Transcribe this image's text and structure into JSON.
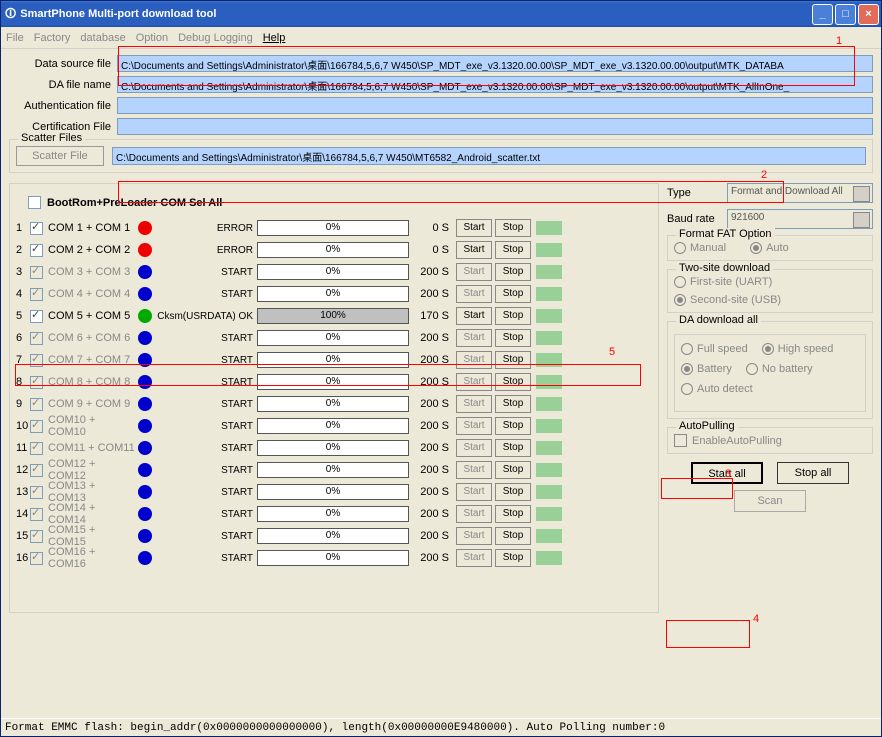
{
  "window_title": "SmartPhone Multi-port download tool",
  "menu": [
    "File",
    "Factory",
    "database",
    "Option",
    "Debug Logging",
    "Help"
  ],
  "menu_active_index": 5,
  "files": {
    "data_source_label": "Data source file",
    "data_source_value": "C:\\Documents and Settings\\Administrator\\桌面\\166784,5,6,7 W450\\SP_MDT_exe_v3.1320.00.00\\SP_MDT_exe_v3.1320.00.00\\output\\MTK_DATABA",
    "da_label": "DA file name",
    "da_value": "C:\\Documents and Settings\\Administrator\\桌面\\166784,5,6,7 W450\\SP_MDT_exe_v3.1320.00.00\\SP_MDT_exe_v3.1320.00.00\\output\\MTK_AllInOne_",
    "auth_label": "Authentication file",
    "auth_value": "",
    "cert_label": "Certification File",
    "cert_value": ""
  },
  "scatter": {
    "legend": "Scatter Files",
    "button": "Scatter File",
    "value": "C:\\Documents and Settings\\Administrator\\桌面\\166784,5,6,7 W450\\MT6582_Android_scatter.txt"
  },
  "com_header": "BootRom+PreLoader COM Sel All",
  "start_label": "Start",
  "stop_label": "Stop",
  "cols": {
    "progress_0": "0%",
    "progress_100": "100%",
    "s0": "0 S",
    "s170": "170 S",
    "s200": "200 S"
  },
  "rows": [
    {
      "idx": "1",
      "name": "COM 1 + COM 1",
      "gray": false,
      "dot": "red",
      "status": "ERROR",
      "pct": "0%",
      "full": false,
      "time": "0 S",
      "start_enabled": true
    },
    {
      "idx": "2",
      "name": "COM 2 + COM 2",
      "gray": false,
      "dot": "red",
      "status": "ERROR",
      "pct": "0%",
      "full": false,
      "time": "0 S",
      "start_enabled": true
    },
    {
      "idx": "3",
      "name": "COM 3 + COM 3",
      "gray": true,
      "dot": "blue",
      "status": "START",
      "pct": "0%",
      "full": false,
      "time": "200 S",
      "start_enabled": false
    },
    {
      "idx": "4",
      "name": "COM 4 + COM 4",
      "gray": true,
      "dot": "blue",
      "status": "START",
      "pct": "0%",
      "full": false,
      "time": "200 S",
      "start_enabled": false
    },
    {
      "idx": "5",
      "name": "COM 5 + COM 5",
      "gray": false,
      "dot": "green",
      "status": "Cksm(USRDATA) OK",
      "pct": "100%",
      "full": true,
      "time": "170 S",
      "start_enabled": true
    },
    {
      "idx": "6",
      "name": "COM 6 + COM 6",
      "gray": true,
      "dot": "blue",
      "status": "START",
      "pct": "0%",
      "full": false,
      "time": "200 S",
      "start_enabled": false
    },
    {
      "idx": "7",
      "name": "COM 7 + COM 7",
      "gray": true,
      "dot": "blue",
      "status": "START",
      "pct": "0%",
      "full": false,
      "time": "200 S",
      "start_enabled": false
    },
    {
      "idx": "8",
      "name": "COM 8 + COM 8",
      "gray": true,
      "dot": "blue",
      "status": "START",
      "pct": "0%",
      "full": false,
      "time": "200 S",
      "start_enabled": false
    },
    {
      "idx": "9",
      "name": "COM 9 + COM 9",
      "gray": true,
      "dot": "blue",
      "status": "START",
      "pct": "0%",
      "full": false,
      "time": "200 S",
      "start_enabled": false
    },
    {
      "idx": "10",
      "name": "COM10 + COM10",
      "gray": true,
      "dot": "blue",
      "status": "START",
      "pct": "0%",
      "full": false,
      "time": "200 S",
      "start_enabled": false
    },
    {
      "idx": "11",
      "name": "COM11 + COM11",
      "gray": true,
      "dot": "blue",
      "status": "START",
      "pct": "0%",
      "full": false,
      "time": "200 S",
      "start_enabled": false
    },
    {
      "idx": "12",
      "name": "COM12 + COM12",
      "gray": true,
      "dot": "blue",
      "status": "START",
      "pct": "0%",
      "full": false,
      "time": "200 S",
      "start_enabled": false
    },
    {
      "idx": "13",
      "name": "COM13 + COM13",
      "gray": true,
      "dot": "blue",
      "status": "START",
      "pct": "0%",
      "full": false,
      "time": "200 S",
      "start_enabled": false
    },
    {
      "idx": "14",
      "name": "COM14 + COM14",
      "gray": true,
      "dot": "blue",
      "status": "START",
      "pct": "0%",
      "full": false,
      "time": "200 S",
      "start_enabled": false
    },
    {
      "idx": "15",
      "name": "COM15 + COM15",
      "gray": true,
      "dot": "blue",
      "status": "START",
      "pct": "0%",
      "full": false,
      "time": "200 S",
      "start_enabled": false
    },
    {
      "idx": "16",
      "name": "COM16 + COM16",
      "gray": true,
      "dot": "blue",
      "status": "START",
      "pct": "0%",
      "full": false,
      "time": "200 S",
      "start_enabled": false
    }
  ],
  "side": {
    "type_label": "Type",
    "type_value": "Format and Download All",
    "baud_label": "Baud rate",
    "baud_value": "921600",
    "fat_legend": "Format FAT Option",
    "fat_manual": "Manual",
    "fat_auto": "Auto",
    "two_legend": "Two-site download",
    "two_first": "First-site (UART)",
    "two_second": "Second-site (USB)",
    "da_legend": "DA download all",
    "da_full": "Full speed",
    "da_high": "High speed",
    "da_batt": "Battery",
    "da_nobatt": "No battery",
    "da_auto": "Auto detect",
    "auto_legend": "AutoPulling",
    "auto_chk": "EnableAutoPulling",
    "start_all": "Start all",
    "stop_all": "Stop all",
    "scan": "Scan"
  },
  "annotations": {
    "a1": "1",
    "a2": "2",
    "a3": "3",
    "a4": "4",
    "a5": "5"
  },
  "footer": "Format EMMC flash:  begin_addr(0x0000000000000000), length(0x00000000E9480000).  Auto Polling number:0"
}
